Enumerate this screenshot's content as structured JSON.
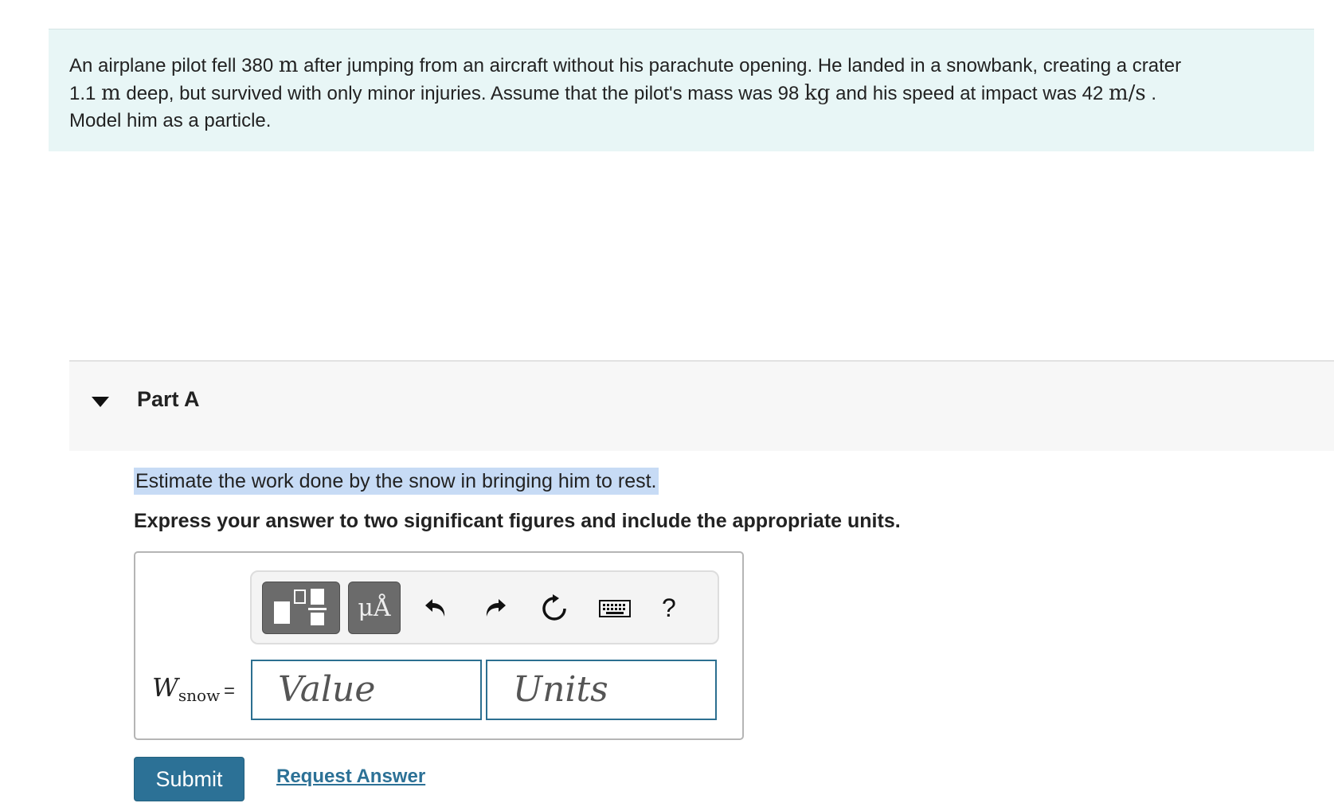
{
  "problem": {
    "seg1": "An airplane pilot fell 380 ",
    "unit_m1": "m",
    "seg2": " after jumping from an aircraft without his parachute opening. He landed in a snowbank, creating a crater",
    "seg3": "1.1 ",
    "unit_m2": "m",
    "seg4": " deep, but survived with only minor injuries. Assume that the pilot's mass was 98 ",
    "unit_kg": "kg",
    "seg5": " and his speed at impact was 42 ",
    "unit_ms": "m/s",
    "seg6": " .",
    "seg7": "Model him as a particle."
  },
  "part": {
    "title": "Part A",
    "caret_icon": "caret-down-icon"
  },
  "question": "Estimate the work done by the snow in bringing him to rest.",
  "instruction": "Express your answer to two significant figures and include the appropriate units.",
  "toolbar": {
    "templates_icon": "templates-icon",
    "symbols_label": "μÅ",
    "undo_icon": "undo-icon",
    "redo_icon": "redo-icon",
    "reset_icon": "reset-icon",
    "keyboard_icon": "keyboard-icon",
    "help_label": "?"
  },
  "answer": {
    "variable": "W",
    "subscript": "snow",
    "equals": "=",
    "value_placeholder": "Value",
    "units_placeholder": "Units"
  },
  "actions": {
    "submit_label": "Submit",
    "request_label": "Request Answer"
  },
  "colors": {
    "problem_bg": "#e8f6f6",
    "accent": "#2c7196",
    "highlight": "#c7dbf5"
  }
}
